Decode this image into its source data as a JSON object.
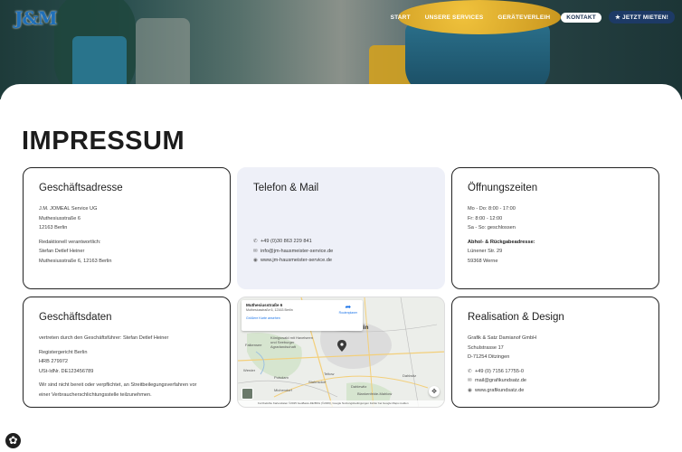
{
  "brand": {
    "logo_text": "J&M"
  },
  "nav": {
    "items": [
      {
        "label": "START"
      },
      {
        "label": "UNSERE SERVICES"
      },
      {
        "label": "GERÄTEVERLEIH"
      },
      {
        "label": "KONTAKT"
      },
      {
        "label": "★ JETZT MIETEN!"
      }
    ]
  },
  "page": {
    "title": "IMPRESSUM"
  },
  "cards": {
    "address": {
      "title": "Geschäftsadresse",
      "lines": [
        "J.M. JOMEAL Service UG",
        "Muthesiusstraße 6",
        "12163 Berlin"
      ],
      "editorial": [
        "Redaktionell verantwortlich:",
        "Stefan Detlef Heiner",
        "Muthesiusstraße 6, 12163 Berlin"
      ]
    },
    "contact": {
      "title": "Telefon & Mail",
      "phone": "+49 (0)30 863 229 841",
      "email": "info@jm-hausmeister-service.de",
      "web": "www.jm-hausmeister-service.de"
    },
    "hours": {
      "title": "Öffnungszeiten",
      "lines": [
        "Mo - Do: 8:00 - 17:00",
        "Fr: 8:00 - 12:00",
        "Sa - So: geschlossen"
      ],
      "pickup_title": "Abhol- & Rückgabeadresse:",
      "pickup_lines": [
        "Lünener Str. 29",
        "59368 Werne"
      ]
    },
    "business": {
      "title": "Geschäftsdaten",
      "represented": "vertreten durch den Geschäftsführer: Stefan Detlef Heiner",
      "register": [
        "Registergericht Berlin",
        "HRB 279972",
        "USt-IdNr. DE123456789"
      ],
      "disclaimer": [
        "Wir sind nicht bereit oder verpflichtet, an Streitbeilegungsverfahren vor",
        "einer Verbraucherschlichtungsstelle teilzunehmen."
      ]
    },
    "design": {
      "title": "Realisation & Design",
      "lines": [
        "Grafik & Satz Damianof GmbH",
        "Schulstrasse 17",
        "D-71254 Ditzingen"
      ],
      "phone": "+49 (0) 7156 17755-0",
      "email": "mail@grafikundsatz.de",
      "web": "www.grafikundsatz.de"
    }
  },
  "map": {
    "place": "Muthesiusstraße 6",
    "address": "Muthesiusstraße 6, 12163 Berlin",
    "larger_map": "Größere Karte ansehen",
    "route": "Routenplaner",
    "city": "Berlin",
    "towns": [
      "Potsdam",
      "Falkensee",
      "Königswald mit Havelseen und Seeburger Agrarlandschaft",
      "Dahlwitz",
      "Dahlewitz",
      "Blankenfelde-Mahlow",
      "Teltow",
      "Stahnsdorf",
      "Michendorf",
      "Werder"
    ],
    "footer": "Kurzbefehle   Kartendaten ©2025 GeoBasis-DE/BKG (©2009), Google   Nutzungsbedingungen   Fehler bei Google Maps melden"
  },
  "icons": {
    "phone": "phone-icon",
    "mail": "mail-icon",
    "web": "globe-icon",
    "settings": "gear-icon"
  },
  "colors": {
    "brand_blue": "#1f6fb8",
    "cta": "#1d3a66",
    "card_shaded": "#eef0f8"
  }
}
